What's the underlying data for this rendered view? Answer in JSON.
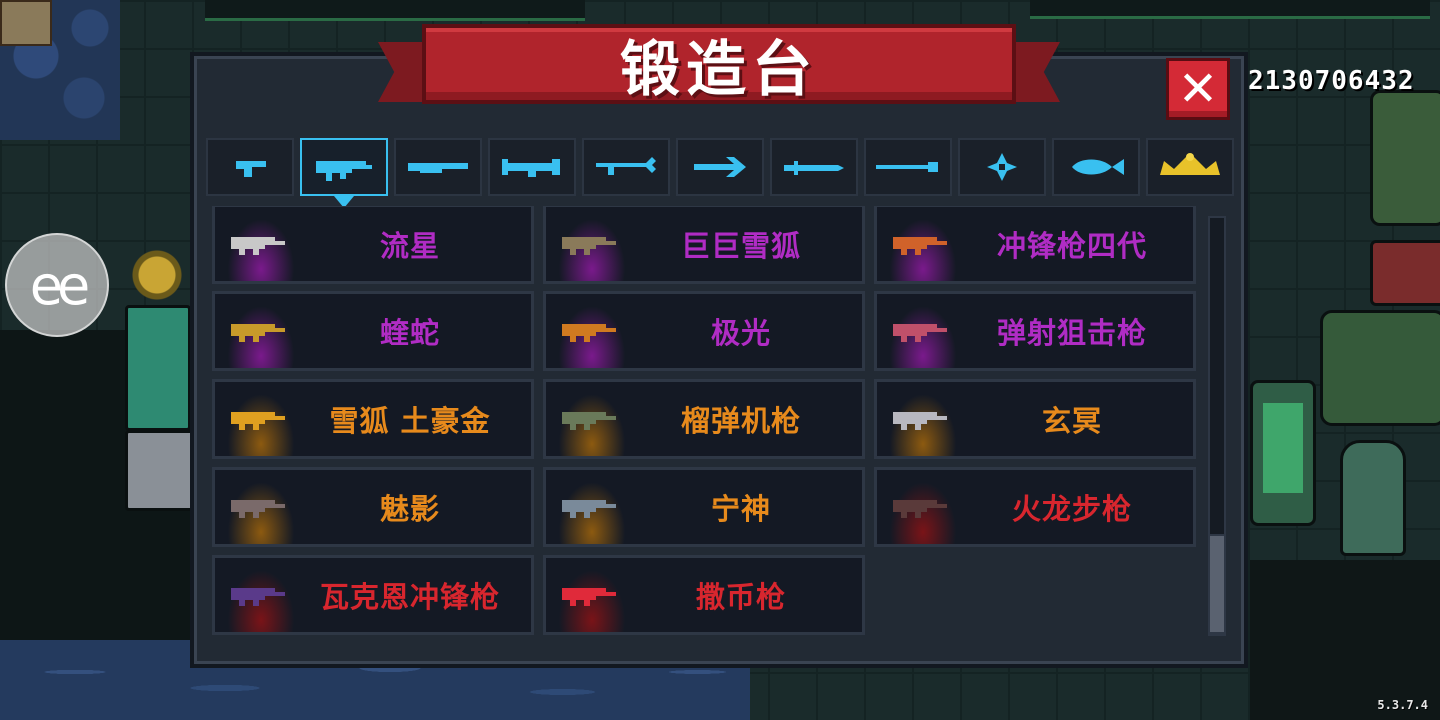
{
  "title": "锻造台",
  "close_icon": "✕",
  "currency_amount": "2130706432",
  "version": "5.3.7.4",
  "overlay_button_label": "ee",
  "colors": {
    "epic": "#b02cc4",
    "legendary": "#e78a1c",
    "red": "#d8262e",
    "tab_accent": "#39c0f0",
    "panel": "#222a34"
  },
  "tabs": [
    {
      "icon": "pistol-icon",
      "selected": false
    },
    {
      "icon": "smg-icon",
      "selected": true
    },
    {
      "icon": "shotgun-icon",
      "selected": false
    },
    {
      "icon": "rocket-launcher-icon",
      "selected": false
    },
    {
      "icon": "bow-icon",
      "selected": false
    },
    {
      "icon": "spear-icon",
      "selected": false
    },
    {
      "icon": "sword-icon",
      "selected": false
    },
    {
      "icon": "staff-icon",
      "selected": false
    },
    {
      "icon": "shuriken-icon",
      "selected": false
    },
    {
      "icon": "fish-icon",
      "selected": false
    },
    {
      "icon": "crown-icon",
      "selected": false
    }
  ],
  "weapons": [
    {
      "name": "流星",
      "rarity": "epic"
    },
    {
      "name": "巨巨雪狐",
      "rarity": "epic"
    },
    {
      "name": "冲锋枪四代",
      "rarity": "epic"
    },
    {
      "name": "蝰蛇",
      "rarity": "epic"
    },
    {
      "name": "极光",
      "rarity": "epic"
    },
    {
      "name": "弹射狙击枪",
      "rarity": "epic"
    },
    {
      "name": "雪狐 土豪金",
      "rarity": "legendary"
    },
    {
      "name": "榴弹机枪",
      "rarity": "legendary"
    },
    {
      "name": "玄冥",
      "rarity": "legendary"
    },
    {
      "name": "魅影",
      "rarity": "legendary"
    },
    {
      "name": "宁神",
      "rarity": "legendary"
    },
    {
      "name": "火龙步枪",
      "rarity": "red"
    },
    {
      "name": "瓦克恩冲锋枪",
      "rarity": "red"
    },
    {
      "name": "撒币枪",
      "rarity": "red"
    }
  ]
}
